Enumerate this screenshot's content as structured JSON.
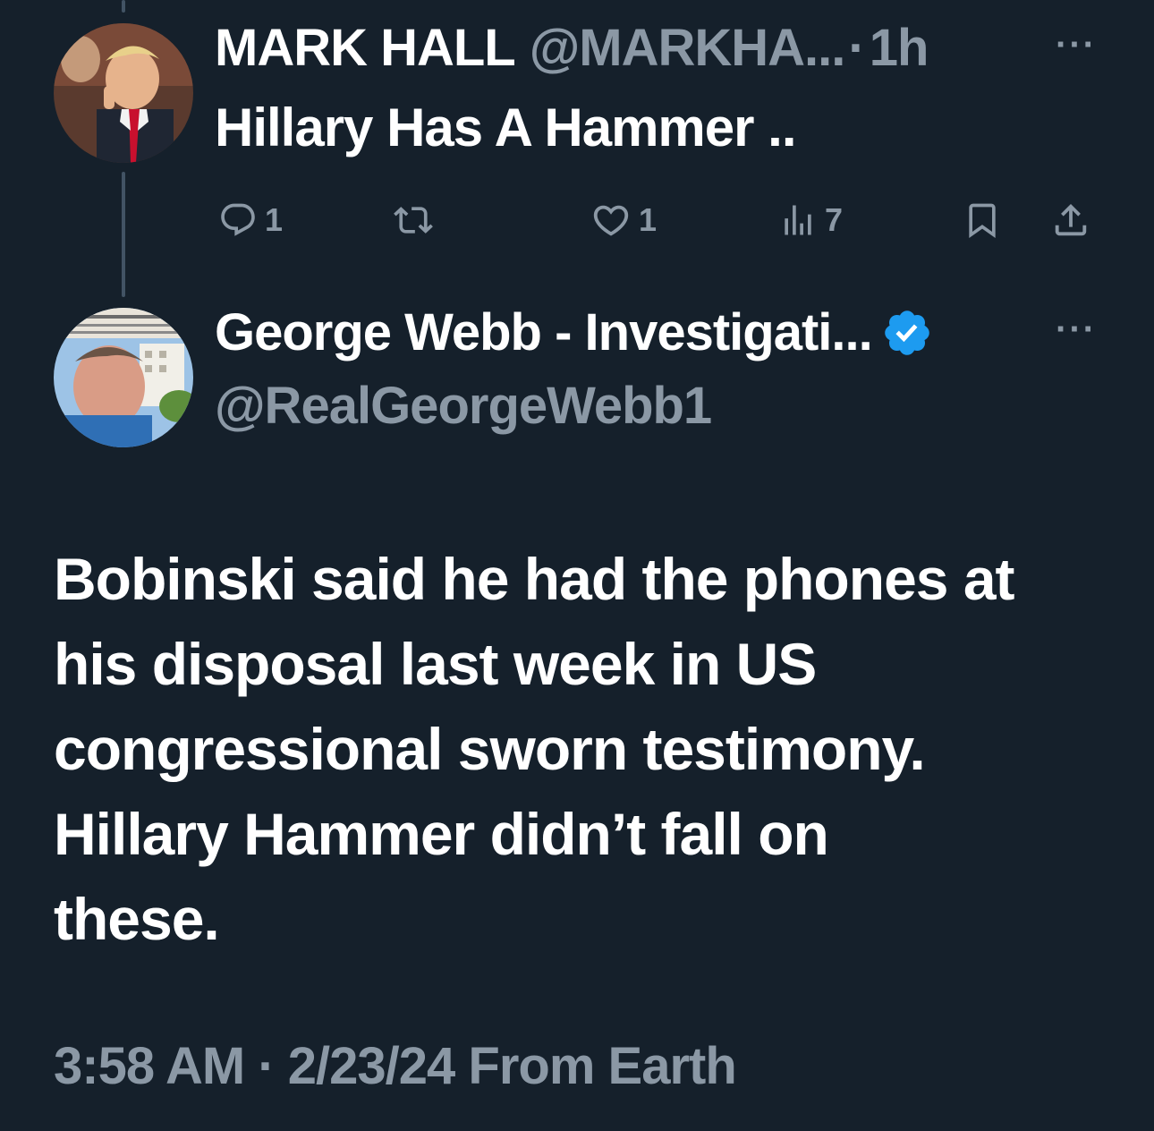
{
  "colors": {
    "background": "#15202b",
    "primary_text": "#ffffff",
    "secondary_text": "#8b98a5",
    "verified_badge": "#1d9bf0",
    "thread_line": "#425364"
  },
  "parent_tweet": {
    "author_name": "MARK HALL",
    "author_handle": "@MARKHA...",
    "separator": "·",
    "time_ago": "1h",
    "more_label": "···",
    "text": "Hillary Has A Hammer ..",
    "avatar_icon": "user-avatar-photo",
    "actions": {
      "reply": {
        "icon": "reply-icon",
        "count": "1"
      },
      "retweet": {
        "icon": "retweet-icon",
        "count": ""
      },
      "like": {
        "icon": "heart-icon",
        "count": "1"
      },
      "views": {
        "icon": "views-icon",
        "count": "7"
      },
      "bookmark": {
        "icon": "bookmark-icon"
      },
      "share": {
        "icon": "share-icon"
      }
    }
  },
  "main_tweet": {
    "author_name": "George Webb - Investigati...",
    "author_handle": "@RealGeorgeWebb1",
    "verified": true,
    "more_label": "···",
    "avatar_icon": "user-avatar-photo",
    "text_lines": [
      "Bobinski said he had the phones at",
      "his disposal last week in US",
      "congressional sworn testimony.",
      "Hillary Hammer didn’t fall on",
      "these."
    ],
    "timestamp": "3:58 AM · 2/23/24 From Earth"
  }
}
